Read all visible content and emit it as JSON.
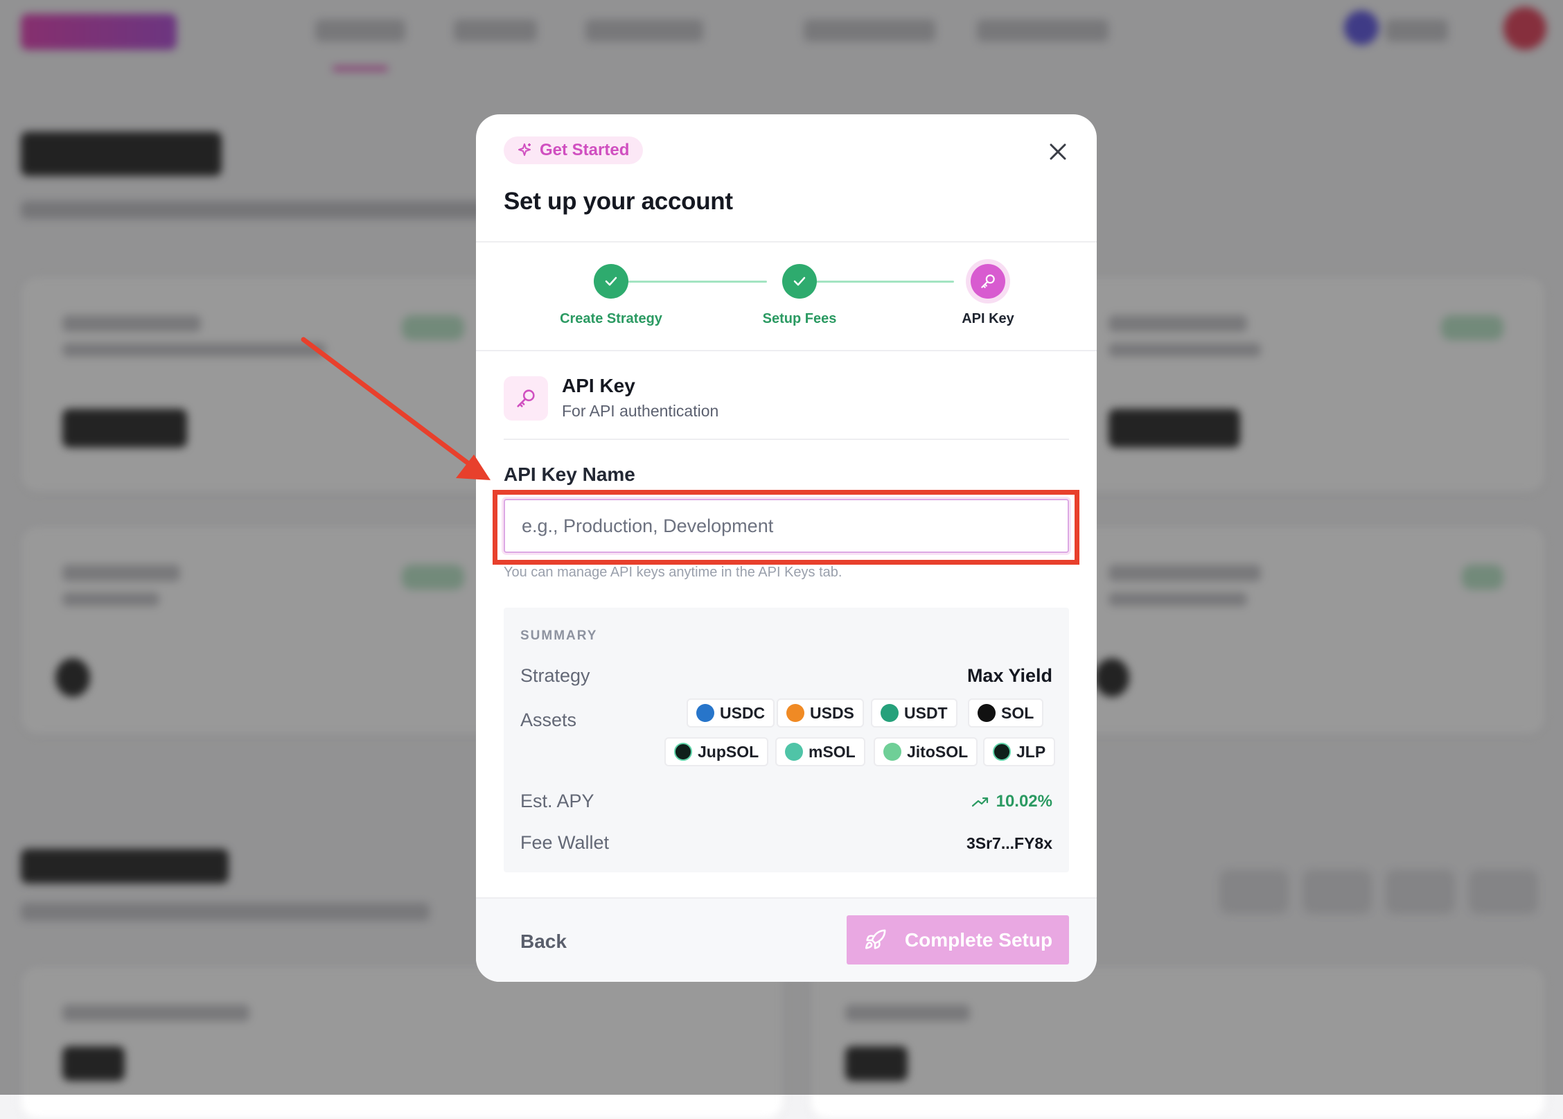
{
  "modal": {
    "badge": {
      "label": "Get Started",
      "icon": "sparkles-icon"
    },
    "title": "Set up your account",
    "close_icon": "close-icon",
    "steps": [
      {
        "label": "Create Strategy",
        "state": "complete",
        "icon": "check-icon"
      },
      {
        "label": "Setup Fees",
        "state": "complete",
        "icon": "check-icon"
      },
      {
        "label": "API Key",
        "state": "active",
        "icon": "key-icon"
      }
    ],
    "section": {
      "icon": "key-icon",
      "title": "API Key",
      "subtitle": "For API authentication"
    },
    "field": {
      "label": "API Key Name",
      "value": "",
      "placeholder": "e.g., Production, Development",
      "hint": "You can manage API keys anytime in the API Keys tab."
    },
    "summary": {
      "heading": "SUMMARY",
      "strategy_label": "Strategy",
      "strategy_value": "Max Yield",
      "assets_label": "Assets",
      "assets": [
        {
          "symbol": "USDC",
          "color": "#2775ca"
        },
        {
          "symbol": "USDS",
          "color": "#f08a24"
        },
        {
          "symbol": "USDT",
          "color": "#26a17b"
        },
        {
          "symbol": "SOL",
          "color": "#111111"
        },
        {
          "symbol": "JupSOL",
          "color": "#0f1f1a"
        },
        {
          "symbol": "mSOL",
          "color": "#4fc4a7"
        },
        {
          "symbol": "JitoSOL",
          "color": "#6fcf97"
        },
        {
          "symbol": "JLP",
          "color": "#0f1f1a"
        }
      ],
      "apy_label": "Est. APY",
      "apy_value": "10.02%",
      "apy_icon": "trending-up-icon",
      "fee_wallet_label": "Fee Wallet",
      "fee_wallet_value": "3Sr7...FY8x"
    },
    "footer": {
      "back_label": "Back",
      "complete_label": "Complete Setup",
      "complete_icon": "rocket-icon"
    }
  },
  "colors": {
    "accent": "#d85bd0",
    "success": "#2eab6e",
    "annotation": "#e8402c"
  }
}
